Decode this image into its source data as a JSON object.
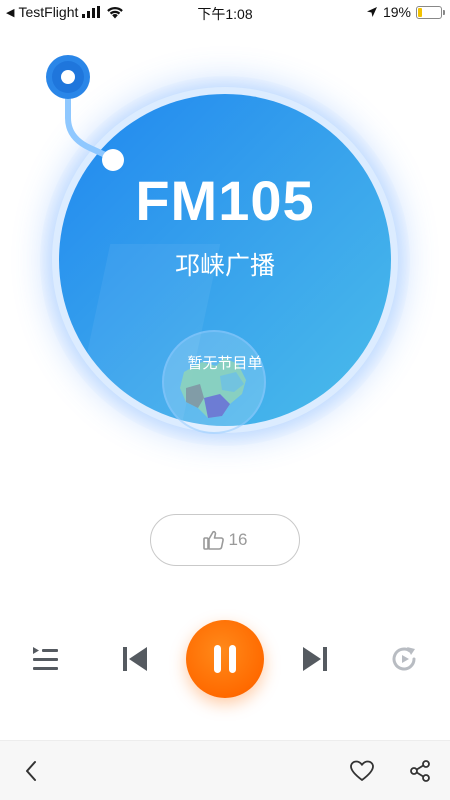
{
  "status_bar": {
    "back_app": "TestFlight",
    "time": "下午1:08",
    "battery_text": "19%",
    "battery_level": 0.19
  },
  "station": {
    "frequency": "FM105",
    "name": "邛崃广播",
    "program": "暂无节目单"
  },
  "like": {
    "count": "16"
  },
  "controls": {
    "playlist": "playlist-icon",
    "previous": "skip-previous-icon",
    "play_pause": "pause-icon",
    "next": "skip-next-icon",
    "replay": "replay-icon"
  },
  "bottom_bar": {
    "back": "chevron-left-icon",
    "favorite": "heart-icon",
    "share": "share-icon"
  },
  "colors": {
    "disc_start": "#1f87ef",
    "disc_end": "#4bbdea",
    "accent": "#ff6a00",
    "icon_gray": "#555a60"
  }
}
